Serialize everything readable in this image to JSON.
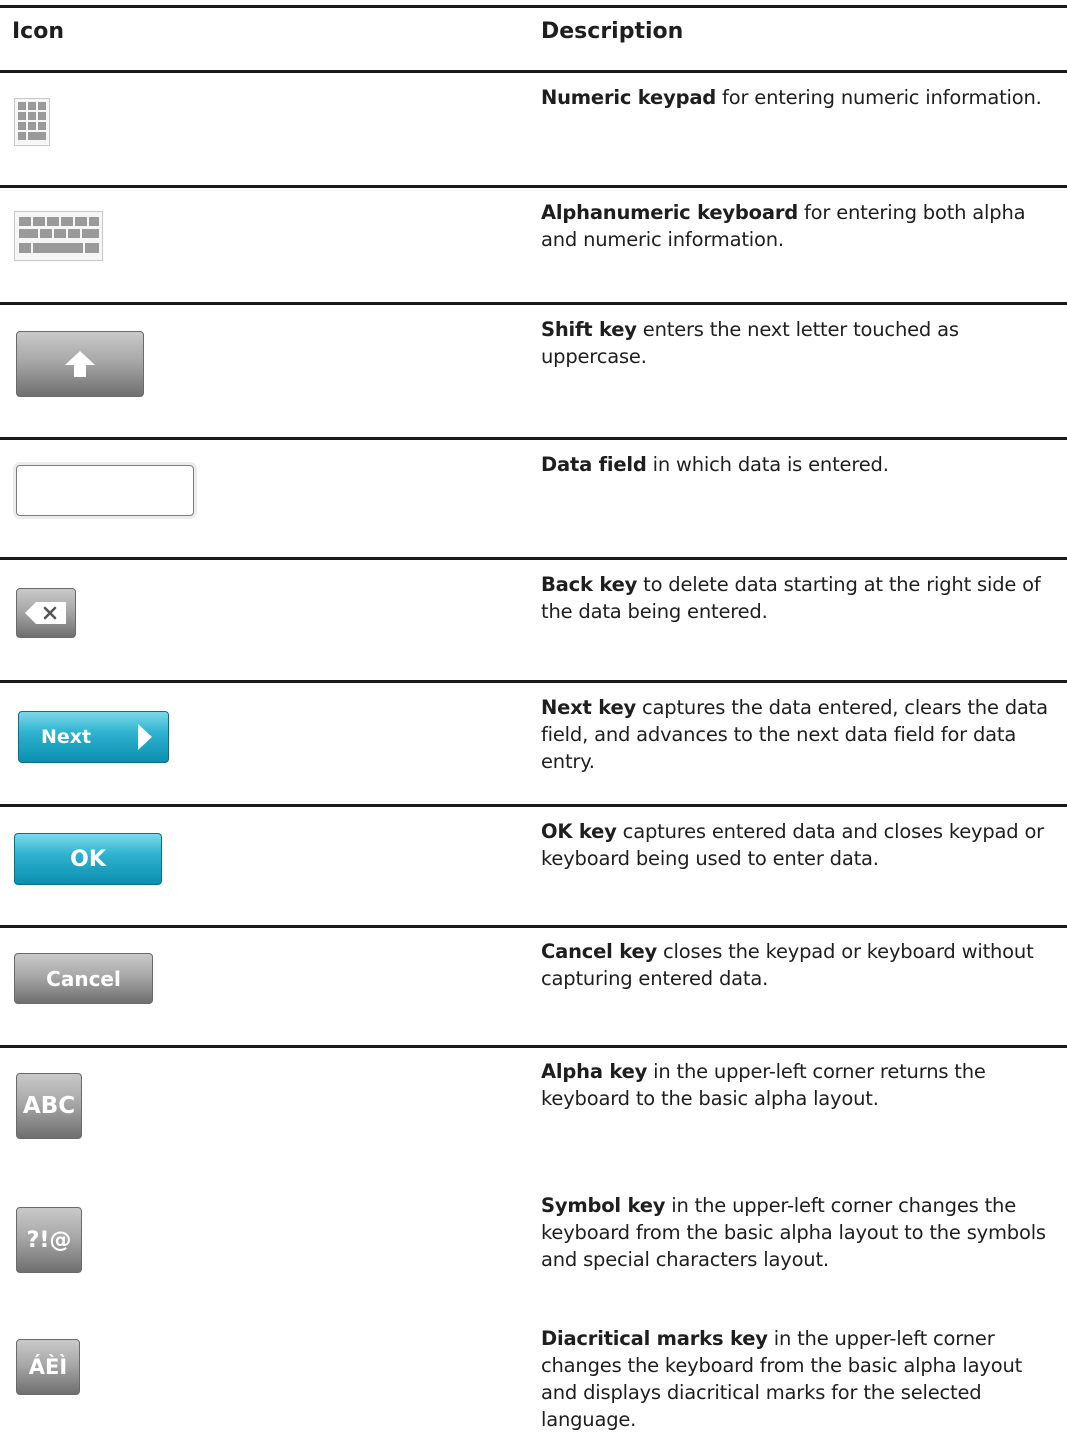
{
  "header": {
    "icon": "Icon",
    "description": "Description"
  },
  "rows": [
    {
      "icon": "numeric-keypad-icon",
      "term": "Numeric keypad",
      "text": " for entering numeric information."
    },
    {
      "icon": "alphanumeric-keyboard-icon",
      "term": "Alphanumeric keyboard",
      "text": " for entering both alpha and numeric information."
    },
    {
      "icon": "shift-key-icon",
      "term": "Shift key",
      "text": " enters the next letter touched as uppercase."
    },
    {
      "icon": "data-field-icon",
      "term": "Data field",
      "text": " in which data is entered."
    },
    {
      "icon": "back-key-icon",
      "term": "Back key",
      "text": " to delete data starting at the right side of the data being entered."
    },
    {
      "icon": "next-key-icon",
      "button_label": "Next",
      "term": "Next key",
      "text": " captures the data entered, clears the data field, and advances to the next data field for data entry."
    },
    {
      "icon": "ok-key-icon",
      "button_label": "OK",
      "term": "OK key",
      "text": " captures entered data and closes keypad or keyboard being used to enter data."
    },
    {
      "icon": "cancel-key-icon",
      "button_label": "Cancel",
      "term": "Cancel key",
      "text": " closes the keypad or keyboard without capturing entered data."
    },
    {
      "icon": "alpha-key-icon",
      "button_label": "ABC",
      "term": "Alpha key",
      "text": " in the upper-left corner returns the keyboard to the basic alpha layout."
    },
    {
      "icon": "symbol-key-icon",
      "button_label": "?!@",
      "term": "Symbol key",
      "text": " in the upper-left corner changes the keyboard from the basic alpha layout to the symbols and special characters layout."
    },
    {
      "icon": "diacritical-key-icon",
      "button_label": "ÁÈÌ",
      "term": "Diacritical marks key",
      "text": " in the upper-left corner changes the keyboard from the basic alpha layout and displays diacritical marks for the selected language."
    }
  ]
}
